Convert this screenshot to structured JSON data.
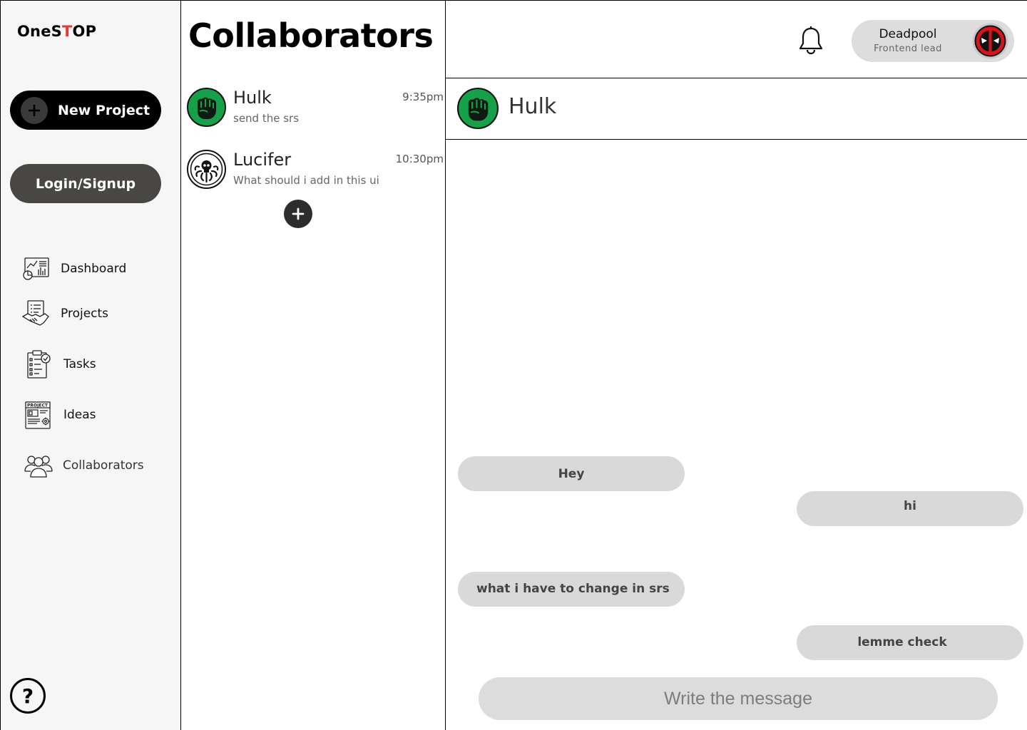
{
  "app": {
    "logo_prefix": "OneS",
    "logo_accent": "T",
    "logo_suffix": "OP",
    "accent_color": "#e53935"
  },
  "sidebar": {
    "new_project_label": "New Project",
    "login_label": "Login/Signup",
    "items": [
      {
        "label": "Dashboard",
        "icon": "dashboard-icon"
      },
      {
        "label": "Projects",
        "icon": "handshake-icon"
      },
      {
        "label": "Tasks",
        "icon": "clipboard-checklist-icon"
      },
      {
        "label": "Ideas",
        "icon": "project-ideas-icon"
      },
      {
        "label": "Collaborators",
        "icon": "people-group-icon"
      }
    ],
    "help_label": "?"
  },
  "collaborators": {
    "title": "Collaborators",
    "contacts": [
      {
        "name": "Hulk",
        "preview": "send the srs",
        "time": "9:35pm",
        "avatar": "hulk-fist-avatar"
      },
      {
        "name": "Lucifer",
        "preview": "What should i add in this ui",
        "time": "10:30pm",
        "avatar": "hydra-skull-avatar"
      }
    ]
  },
  "topbar": {
    "user_name": "Deadpool",
    "user_role": "Frontend lead",
    "user_avatar": "deadpool-mask-avatar"
  },
  "chat": {
    "contact_name": "Hulk",
    "messages": [
      {
        "text": "Hey",
        "side": "received"
      },
      {
        "text": "hi",
        "side": "sent"
      },
      {
        "text": "what i have to change in srs",
        "side": "received"
      },
      {
        "text": "lemme check",
        "side": "sent"
      }
    ],
    "composer_placeholder": "Write the message"
  }
}
